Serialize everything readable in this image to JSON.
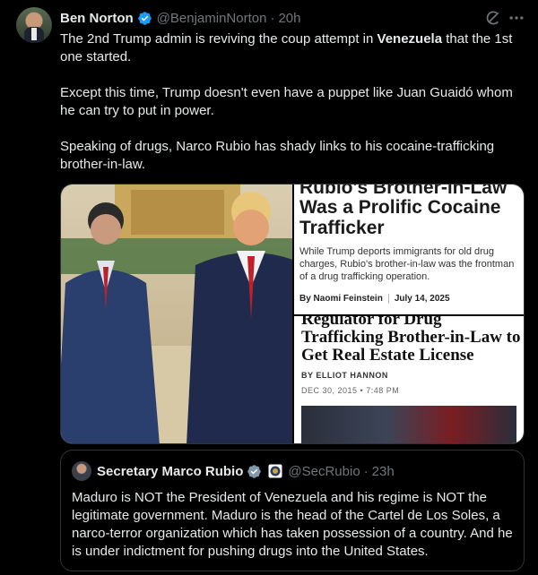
{
  "post": {
    "author_name": "Ben Norton",
    "author_handle": "@BenjaminNorton",
    "separator": "·",
    "time": "20h",
    "paragraph1_pre": "The 2nd Trump admin is reviving the coup attempt in ",
    "paragraph1_bold": "Venezuela",
    "paragraph1_post": " that the 1st one started.",
    "paragraph2": "Except this time, Trump doesn't even have a puppet like Juan Guaidó whom he can try to put in power.",
    "paragraph3": "Speaking of drugs, Narco Rubio has shady links to his cocaine-trafficking brother-in-law."
  },
  "media": {
    "article1": {
      "headline_top": "Rubio's Brother-in-Law",
      "headline_rest": "Was a Prolific Cocaine Trafficker",
      "dek": "While Trump deports immigrants for old drug charges, Rubio's brother-in-law was the frontman of a drug trafficking operation.",
      "byline": "By Naomi Feinstein",
      "date": "July 14, 2025"
    },
    "article2": {
      "headline_top": "Regulator for Drug",
      "headline_rest": "Trafficking Brother-in-Law to Get Real Estate License",
      "byline": "BY ELLIOT HANNON",
      "date": "DEC 30, 2015 • 7:48 PM"
    }
  },
  "quote": {
    "author_name": "Secretary Marco Rubio",
    "author_handle": "@SecRubio",
    "separator": "·",
    "time": "23h",
    "text": "Maduro is NOT the President of Venezuela and his regime is NOT the legitimate government.  Maduro is the head of the Cartel de Los Soles, a narco-terror organization which has taken possession of a country. And he is under indictment for pushing drugs into the United States."
  },
  "icons": {
    "verified": "verified-badge-icon",
    "gov": "government-badge-icon",
    "grok": "grok-icon",
    "more": "more-icon"
  },
  "colors": {
    "background": "#000000",
    "text": "#e7e9ea",
    "muted": "#71767b",
    "verified_blue": "#1d9bf0",
    "gov_gray": "#829aab",
    "border": "#2f3336"
  }
}
